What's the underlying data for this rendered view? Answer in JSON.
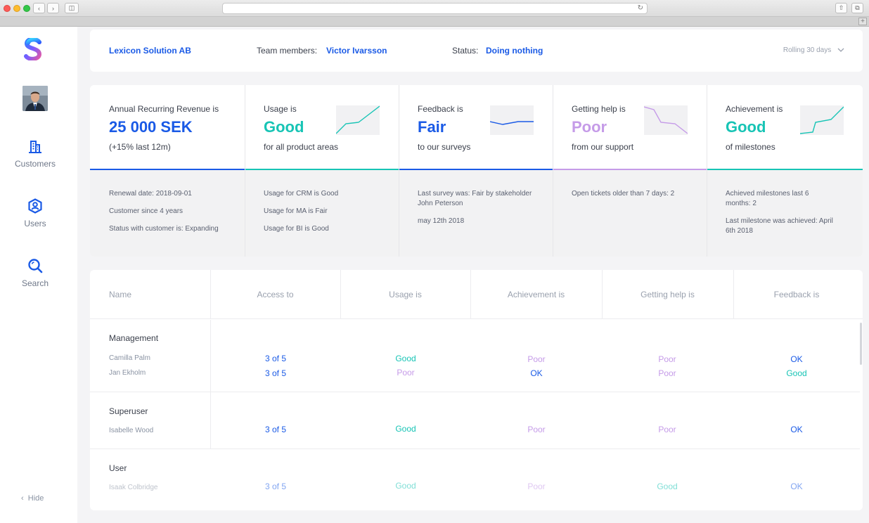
{
  "company": "Lexicon Solution AB",
  "team_members_label": "Team members:",
  "team_member": "Victor Ivarsson",
  "status_label": "Status:",
  "status_value": "Doing nothing",
  "period": "Rolling 30 days",
  "sidebar": {
    "items": [
      {
        "label": "Customers",
        "icon": "building-icon"
      },
      {
        "label": "Users",
        "icon": "user-circle-icon"
      },
      {
        "label": "Search",
        "icon": "search-icon"
      }
    ],
    "hide": "Hide"
  },
  "metrics": [
    {
      "label": "Annual Recurring Revenue is",
      "value": "25 000 SEK",
      "sub": "(+15% last 12m)",
      "color": "#1a5ae6",
      "details": [
        "Renewal date: 2018-09-01",
        "Customer since 4 years",
        "Status with customer is: Expanding"
      ]
    },
    {
      "label": "Usage is",
      "value": "Good",
      "sub": "for all product areas",
      "color": "#17c4b5",
      "details": [
        "Usage for CRM is Good",
        "Usage for MA is Fair",
        "Usage for BI is Good"
      ]
    },
    {
      "label": "Feedback is",
      "value": "Fair",
      "sub": "to our surveys",
      "color": "#1a5ae6",
      "details": [
        "Last survey was: Fair by stakeholder John Peterson",
        "may 12th 2018"
      ]
    },
    {
      "label": "Getting help is",
      "value": "Poor",
      "sub": "from our support",
      "color": "#c59be8",
      "details": [
        "Open tickets older than 7 days: 2"
      ]
    },
    {
      "label": "Achievement is",
      "value": "Good",
      "sub": "of milestones",
      "color": "#17c4b5",
      "details": [
        "Achieved milestones last 6 months: 2",
        "Last milestone was achieved: April 6th 2018"
      ]
    }
  ],
  "table": {
    "headers": [
      "Name",
      "Access to",
      "Usage is",
      "Achievement is",
      "Getting help is",
      "Feedback is"
    ],
    "groups": [
      {
        "name": "Management",
        "rows": [
          {
            "person": "Camilla Palm",
            "access": "3 of 5",
            "usage": "Good",
            "achievement": "Poor",
            "help": "Poor",
            "feedback": "OK"
          },
          {
            "person": "Jan Ekholm",
            "access": "3 of 5",
            "usage": "Poor",
            "achievement": "OK",
            "help": "Poor",
            "feedback": "Good"
          }
        ]
      },
      {
        "name": "Superuser",
        "rows": [
          {
            "person": "Isabelle Wood",
            "access": "3 of 5",
            "usage": "Good",
            "achievement": "Poor",
            "help": "Poor",
            "feedback": "OK"
          }
        ]
      },
      {
        "name": "User",
        "rows": [
          {
            "person": "Isaak Colbridge",
            "access": "3 of 5",
            "usage": "Good",
            "achievement": "Poor",
            "help": "Good",
            "feedback": "OK"
          }
        ]
      }
    ]
  },
  "colors": {
    "blue": "#1a5ae6",
    "teal": "#17c4b5",
    "purple": "#c59be8"
  }
}
